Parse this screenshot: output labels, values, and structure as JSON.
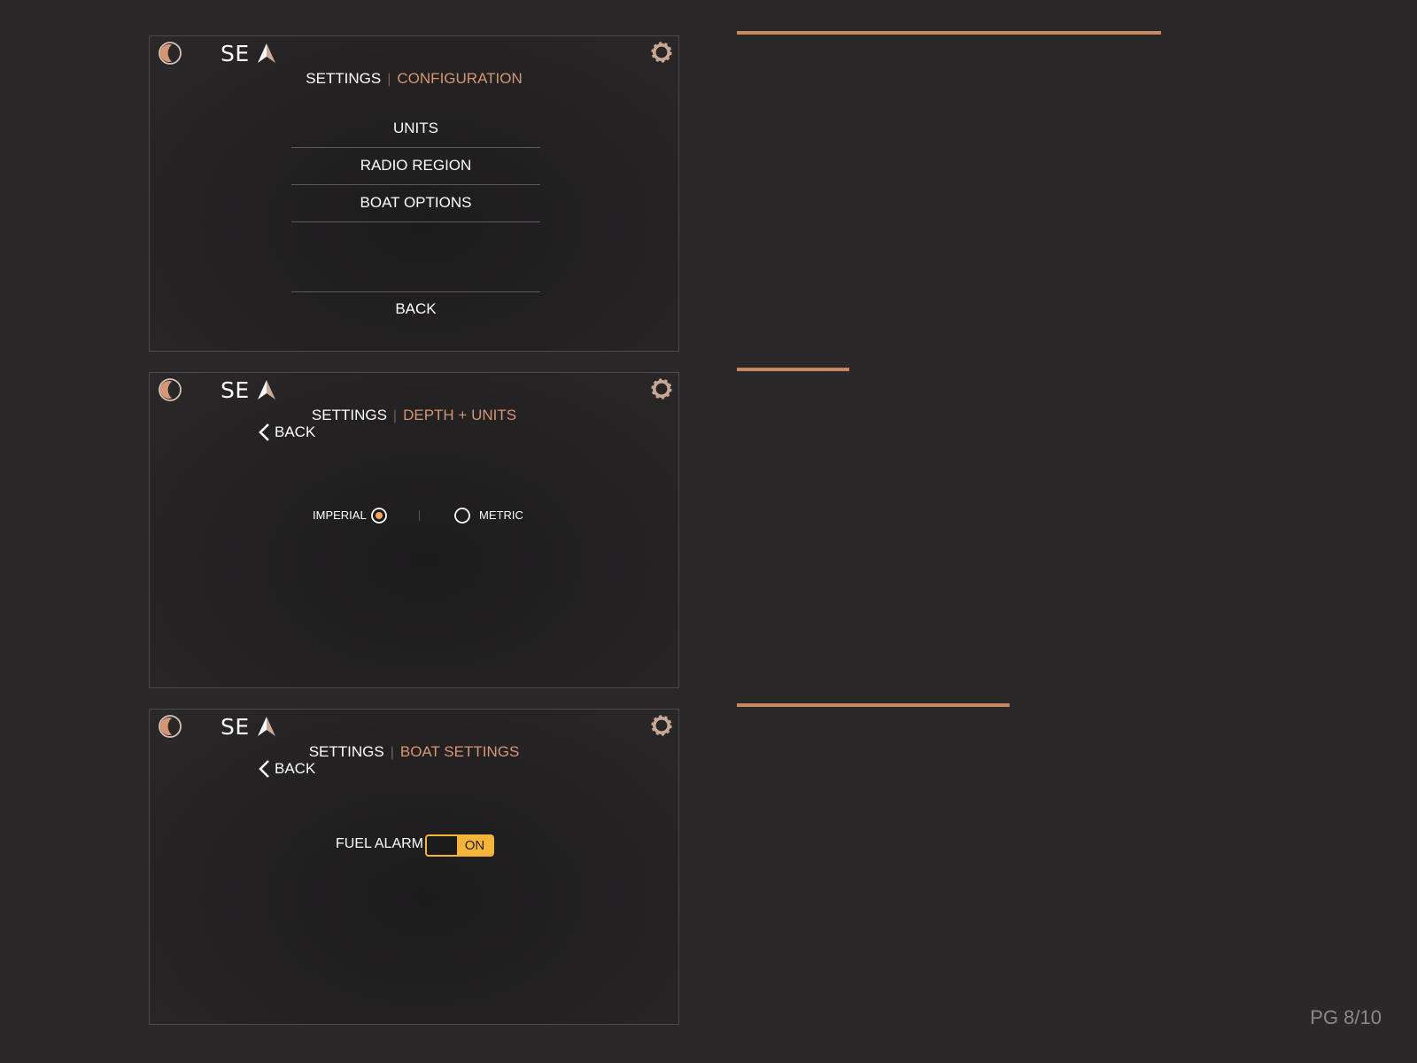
{
  "colors": {
    "background": "#2a2829",
    "accent": "#d69675",
    "toggle_on": "#f4b53a",
    "text": "#ffffff"
  },
  "screens": [
    {
      "heading": "SE",
      "title": "SETTINGS",
      "separator": "|",
      "subtitle": "CONFIGURATION",
      "menu_items": [
        "UNITS",
        "RADIO REGION",
        "BOAT OPTIONS"
      ],
      "back_label": "BACK",
      "icons": [
        "moon-icon",
        "navigation-arrow-icon",
        "gear-icon"
      ]
    },
    {
      "heading": "SE",
      "title": "SETTINGS",
      "separator": "|",
      "subtitle": "DEPTH + UNITS",
      "back_label": "BACK",
      "units_options": [
        "IMPERIAL",
        "METRIC"
      ],
      "units_selected": "IMPERIAL",
      "icons": [
        "moon-icon",
        "navigation-arrow-icon",
        "gear-icon",
        "chevron-left-icon",
        "radio-icon"
      ]
    },
    {
      "heading": "SE",
      "title": "SETTINGS",
      "separator": "|",
      "subtitle": "BOAT SETTINGS",
      "back_label": "BACK",
      "fuel_alarm_label": "FUEL ALARM",
      "fuel_alarm_state": "ON",
      "icons": [
        "moon-icon",
        "navigation-arrow-icon",
        "gear-icon",
        "chevron-left-icon",
        "toggle-icon"
      ]
    }
  ],
  "footer": {
    "page_label": "PG 8/10"
  }
}
